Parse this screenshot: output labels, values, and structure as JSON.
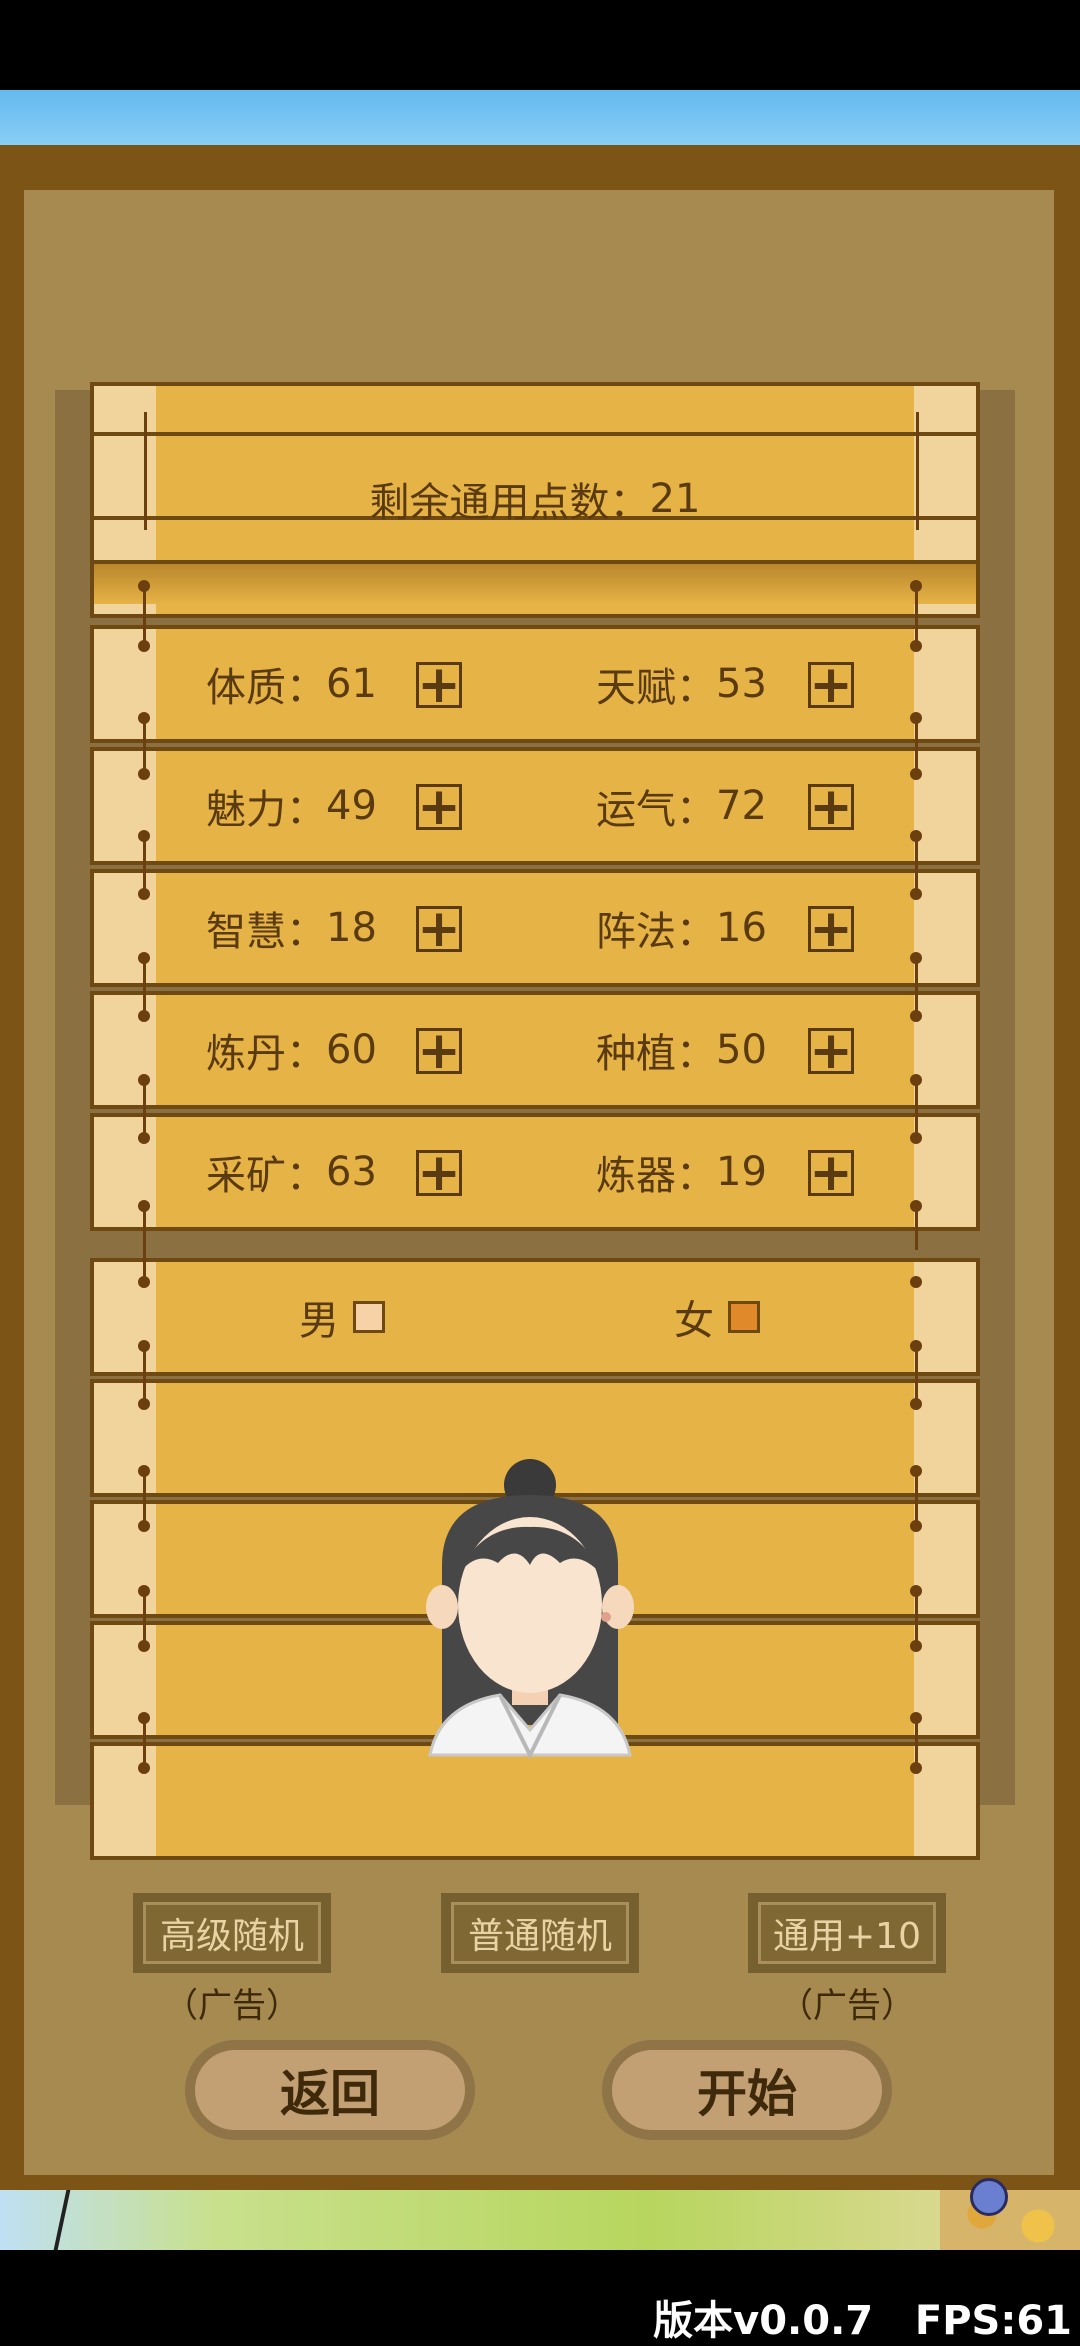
{
  "remaining_points": {
    "label": "剩余通用点数：",
    "value": "21"
  },
  "stats": [
    {
      "label": "体质：",
      "value": "61"
    },
    {
      "label": "天赋：",
      "value": "53"
    },
    {
      "label": "魅力：",
      "value": "49"
    },
    {
      "label": "运气：",
      "value": "72"
    },
    {
      "label": "智慧：",
      "value": "18"
    },
    {
      "label": "阵法：",
      "value": "16"
    },
    {
      "label": "炼丹：",
      "value": "60"
    },
    {
      "label": "种植：",
      "value": "50"
    },
    {
      "label": "采矿：",
      "value": "63"
    },
    {
      "label": "炼器：",
      "value": "19"
    }
  ],
  "plus_symbol": "+",
  "gender": {
    "male": "男",
    "female": "女",
    "male_color": "#f6d2a6",
    "female_color": "#e0892b"
  },
  "buttons": {
    "advanced_random": "高级随机",
    "normal_random": "普通随机",
    "general_plus10": "通用+10",
    "ad_note_left": "（广告）",
    "ad_note_right": "（广告）",
    "back": "返回",
    "start": "开始"
  },
  "footer": {
    "version": "版本v0.0.7",
    "fps": "FPS:61"
  }
}
